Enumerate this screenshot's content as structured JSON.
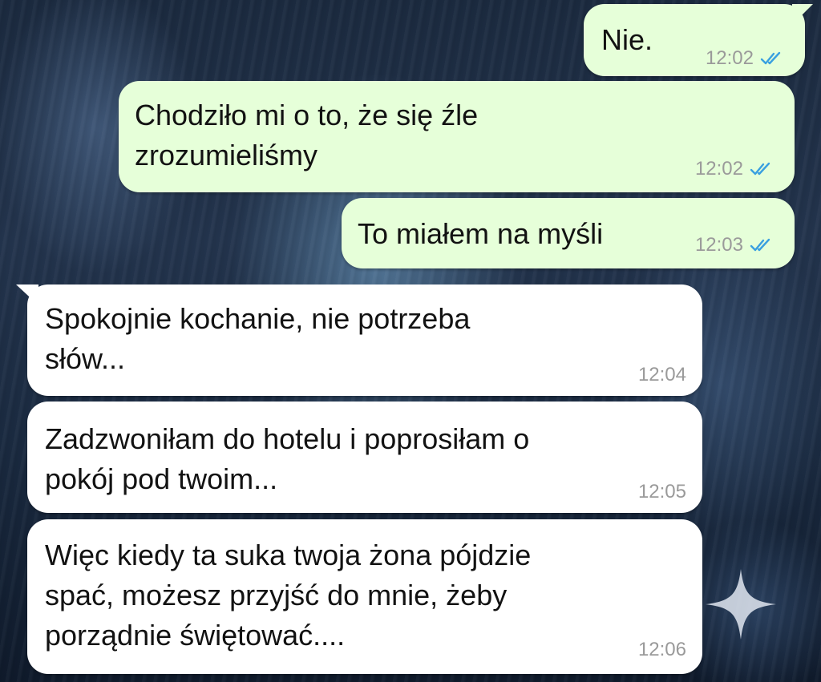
{
  "messages": [
    {
      "direction": "outgoing",
      "lines": [
        "Nie."
      ],
      "time": "12:02",
      "status": "read"
    },
    {
      "direction": "outgoing",
      "lines": [
        "Chodziło mi o to, że się źle",
        "zrozumieliśmy"
      ],
      "time": "12:02",
      "status": "read"
    },
    {
      "direction": "outgoing",
      "lines": [
        "To miałem na myśli"
      ],
      "time": "12:03",
      "status": "read"
    },
    {
      "direction": "incoming",
      "lines": [
        "Spokojnie kochanie, nie potrzeba",
        "słów..."
      ],
      "time": "12:04"
    },
    {
      "direction": "incoming",
      "lines": [
        "Zadzwoniłam do hotelu i poprosiłam o",
        "pokój pod twoim..."
      ],
      "time": "12:05"
    },
    {
      "direction": "incoming",
      "lines": [
        "Więc kiedy ta suka twoja żona pójdzie",
        "spać, możesz przyjść do mnie, żeby",
        "porządnie świętować...."
      ],
      "time": "12:06"
    }
  ],
  "colors": {
    "outgoing_bubble": "#e6ffd9",
    "incoming_bubble": "#ffffff",
    "read_ticks": "#3aa0e0",
    "timestamp": "#9a9a9a"
  },
  "icons": {
    "read_receipt": "double-check-icon",
    "sparkle": "sparkle-icon"
  }
}
